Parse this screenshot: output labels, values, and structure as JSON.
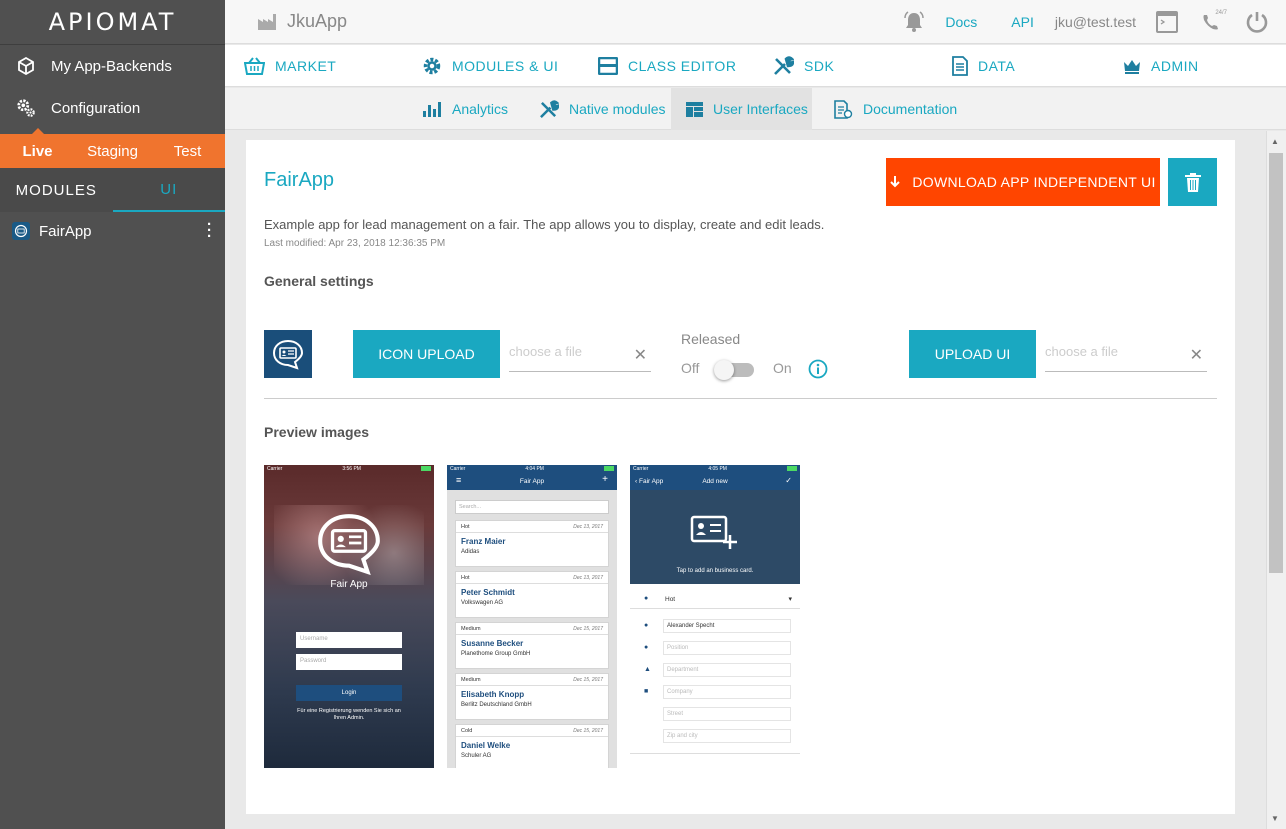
{
  "brand": {
    "logo_text": "APIOMAT"
  },
  "sidebar": {
    "nav": [
      {
        "label": "My App-Backends",
        "icon": "cube-icon"
      },
      {
        "label": "Configuration",
        "icon": "gears-icon"
      }
    ],
    "env_tabs": [
      {
        "label": "Live",
        "active": true
      },
      {
        "label": "Staging",
        "active": false
      },
      {
        "label": "Test",
        "active": false
      }
    ],
    "module_tabs": [
      {
        "label": "MODULES",
        "active": false
      },
      {
        "label": "UI",
        "active": true
      }
    ],
    "app_item": {
      "label": "FairApp"
    }
  },
  "topbar": {
    "app_title": "JkuApp",
    "links": {
      "docs": "Docs",
      "api": "API"
    },
    "user": "jku@test.test",
    "support_badge": "24/7"
  },
  "mainnav": {
    "market": "MARKET",
    "modules_ui": "MODULES & UI",
    "class_editor": "CLASS EDITOR",
    "sdk": "SDK",
    "data": "DATA",
    "admin": "ADMIN"
  },
  "subnav": {
    "analytics": "Analytics",
    "native_modules": "Native modules",
    "user_interfaces": "User Interfaces",
    "documentation": "Documentation"
  },
  "content": {
    "app_name": "FairApp",
    "download_button": "DOWNLOAD APP INDEPENDENT UI",
    "description": "Example app for lead management on a fair. The app allows you to display, create and edit leads.",
    "last_modified": "Last modified: Apr 23, 2018 12:36:35 PM",
    "general_settings": "General settings",
    "icon_upload": "ICON UPLOAD",
    "file_placeholder": "choose a file",
    "released_label": "Released",
    "off_label": "Off",
    "on_label": "On",
    "released": false,
    "upload_ui": "UPLOAD UI",
    "preview_images": "Preview images"
  },
  "previews": {
    "login": {
      "carrier": "Carrier",
      "time": "3:56 PM",
      "title": "Fair App",
      "username": "Username",
      "password": "Password",
      "login": "Login",
      "hint": "Für eine Registrierung wenden Sie sich an Ihren Admin."
    },
    "list": {
      "carrier": "Carrier",
      "time": "4:04 PM",
      "title": "Fair App",
      "search": "Search...",
      "leads": [
        {
          "priority": "Hot",
          "date": "Dec 13, 2017",
          "name": "Franz Maier",
          "company": "Adidas"
        },
        {
          "priority": "Hot",
          "date": "Dec 13, 2017",
          "name": "Peter Schmidt",
          "company": "Volkswagen AG"
        },
        {
          "priority": "Medium",
          "date": "Dec 15, 2017",
          "name": "Susanne Becker",
          "company": "Planethome Group GmbH"
        },
        {
          "priority": "Medium",
          "date": "Dec 15, 2017",
          "name": "Elisabeth Knopp",
          "company": "Berlitz Deutschland GmbH"
        },
        {
          "priority": "Cold",
          "date": "Dec 15, 2017",
          "name": "Daniel Welke",
          "company": "Schuler AG"
        }
      ]
    },
    "add": {
      "carrier": "Carrier",
      "time": "4:05 PM",
      "back": "Fair App",
      "title": "Add new",
      "tap_hint": "Tap to add an business card.",
      "priority": "Hot",
      "name": "Alexander Specht",
      "position": "Position",
      "department": "Department",
      "company": "Company",
      "street": "Street",
      "zip": "Zip and city"
    }
  },
  "colors": {
    "accent": "#1aa8c1",
    "orange": "#f0742e",
    "danger": "#ff4500",
    "sidebar": "#505050",
    "navy": "#1e4e7e"
  }
}
